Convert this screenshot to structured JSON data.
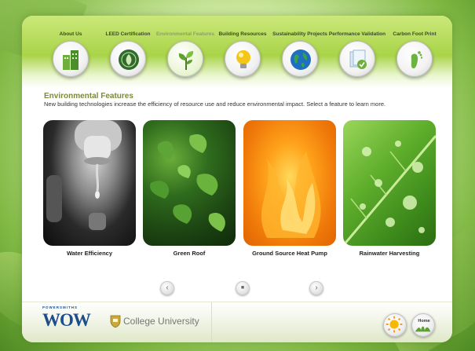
{
  "nav": {
    "items": [
      {
        "label": "About Us",
        "icon": "buildings-icon"
      },
      {
        "label": "LEED Certification",
        "icon": "leed-seal-icon"
      },
      {
        "label": "Environmental Features",
        "icon": "plant-icon"
      },
      {
        "label": "Building Resources",
        "icon": "lightbulb-icon"
      },
      {
        "label": "Sustainability Projects",
        "icon": "globe-icon"
      },
      {
        "label": "Performance Validation",
        "icon": "checked-documents-icon"
      },
      {
        "label": "Carbon Foot Print",
        "icon": "footprint-icon"
      }
    ],
    "active_index": 2
  },
  "main": {
    "title": "Environmental Features",
    "description": "New building technologies increase the efficiency of resource use and reduce environmental impact. Select a feature to learn more.",
    "features": [
      {
        "label": "Water Efficiency",
        "image": "dripping-faucet"
      },
      {
        "label": "Green Roof",
        "image": "green-foliage"
      },
      {
        "label": "Ground Source Heat Pump",
        "image": "orange-flames"
      },
      {
        "label": "Rainwater Harvesting",
        "image": "leaf-with-water-droplets"
      }
    ]
  },
  "pager": {
    "prev": "‹",
    "current": "■",
    "next": "›"
  },
  "footer": {
    "logo_top": "POWERSMITHS",
    "logo_main": "WOW",
    "college_name": "College University",
    "home_label": "Home"
  },
  "colors": {
    "accent_green": "#a9d448",
    "title_olive": "#7b8a3a",
    "brand_blue": "#1d4d8c"
  }
}
